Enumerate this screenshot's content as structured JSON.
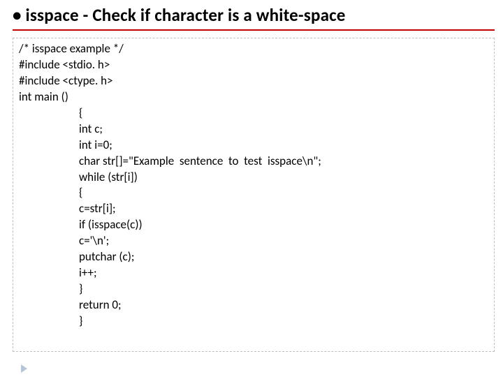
{
  "title": "• isspace - Check if character is a white-space",
  "code": {
    "l00": "/* isspace example */",
    "l01": "#include <stdio. h>",
    "l02": "#include <ctype. h>",
    "l03": "int main ()",
    "l04": "{",
    "l05": "int c;",
    "l06": "int i=0;",
    "l07": "char str[]=\"Example  sentence  to  test  isspace\\n\";",
    "l08": "while (str[i])",
    "l09": "{",
    "l10": "c=str[i];",
    "l11": "if (isspace(c))",
    "l12": "c='\\n';",
    "l13": "putchar (c);",
    "l14": "i++;",
    "l15": "}",
    "l16": "return 0;",
    "l17": "}"
  }
}
